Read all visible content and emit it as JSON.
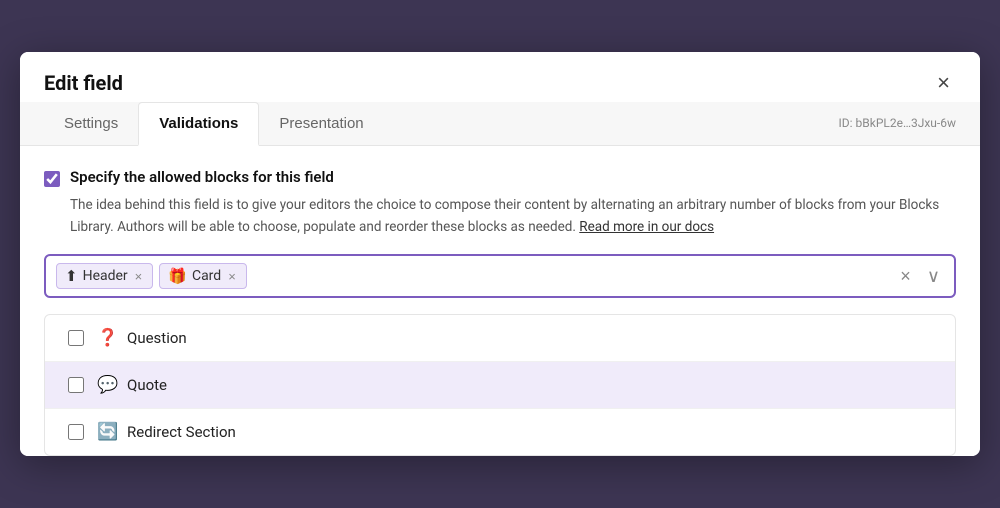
{
  "modal": {
    "title": "Edit field",
    "close_label": "×"
  },
  "tabs": {
    "items": [
      {
        "label": "Settings",
        "active": false
      },
      {
        "label": "Validations",
        "active": true
      },
      {
        "label": "Presentation",
        "active": false
      }
    ],
    "id_label": "ID: bBkPL2e…3Jxu-6w"
  },
  "content": {
    "checkbox_label": "Specify the allowed blocks for this field",
    "checkbox_checked": true,
    "description": "The idea behind this field is to give your editors the choice to compose their content by alternating an arbitrary number of blocks from your Blocks Library. Authors will be able to choose, populate and reorder these blocks as needed.",
    "docs_link": "Read more in our docs",
    "tags": [
      {
        "icon": "⬆",
        "label": "Header"
      },
      {
        "icon": "🎁",
        "label": "Card"
      }
    ],
    "clear_label": "×",
    "chevron_label": "⌄",
    "dropdown_items": [
      {
        "icon": "❓",
        "label": "Question",
        "checked": false
      },
      {
        "icon": "💬",
        "label": "Quote",
        "checked": false,
        "highlighted": true
      },
      {
        "icon": "🔄",
        "label": "Redirect Section",
        "checked": false
      }
    ]
  }
}
